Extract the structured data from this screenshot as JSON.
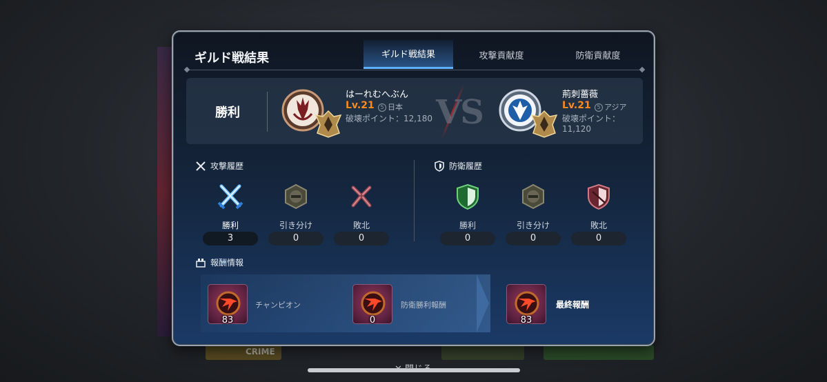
{
  "background": {
    "strip_text": "CRIME",
    "close_label": "✕ 閉じる"
  },
  "dialog": {
    "title": "ギルド戦結果",
    "tabs": [
      {
        "label": "ギルド戦結果",
        "active": true
      },
      {
        "label": "攻撃貢献度",
        "active": false
      },
      {
        "label": "防衛貢献度",
        "active": false
      }
    ]
  },
  "result": {
    "outcome": "勝利",
    "vs": "VS",
    "guild_left": {
      "name": "はーれむへぶん",
      "level": "Lv.21",
      "region": "日本",
      "server_badge": "5",
      "points": "破壊ポイント：12,180",
      "emblem_icon": "trident-emblem-icon",
      "rank_icon": "gold-rank-icon"
    },
    "guild_right": {
      "name": "荊刺薔薇",
      "level": "Lv.21",
      "region": "アジア",
      "server_badge": "5",
      "points": "破壊ポイント：11,120",
      "emblem_icon": "flame-emblem-icon",
      "rank_icon": "gold-rank-icon"
    }
  },
  "attack": {
    "heading": "攻撃履歴",
    "stats": [
      {
        "label": "勝利",
        "value": "3",
        "icon": "crossed-swords-icon"
      },
      {
        "label": "引き分け",
        "value": "0",
        "icon": "draw-hexagon-icon"
      },
      {
        "label": "敗北",
        "value": "0",
        "icon": "broken-swords-icon"
      }
    ]
  },
  "defense": {
    "heading": "防衛履歴",
    "stats": [
      {
        "label": "勝利",
        "value": "0",
        "icon": "green-shield-icon"
      },
      {
        "label": "引き分け",
        "value": "0",
        "icon": "draw-hexagon-icon"
      },
      {
        "label": "敗北",
        "value": "0",
        "icon": "broken-shield-icon"
      }
    ]
  },
  "rewards": {
    "heading": "報酬情報",
    "items": [
      {
        "name": "チャンピオン",
        "qty": "83",
        "icon": "reward-token-icon"
      },
      {
        "name": "防衛勝利報酬",
        "qty": "0",
        "icon": "reward-token-icon"
      },
      {
        "name": "最終報酬",
        "qty": "83",
        "icon": "reward-token-icon"
      }
    ]
  },
  "colors": {
    "accent_blue": "#5fb0ff",
    "level_orange": "#ff8a1a",
    "win_blue": "#4aa8ff",
    "defense_green": "#3fbf5a",
    "loss_red": "#c94a55"
  }
}
